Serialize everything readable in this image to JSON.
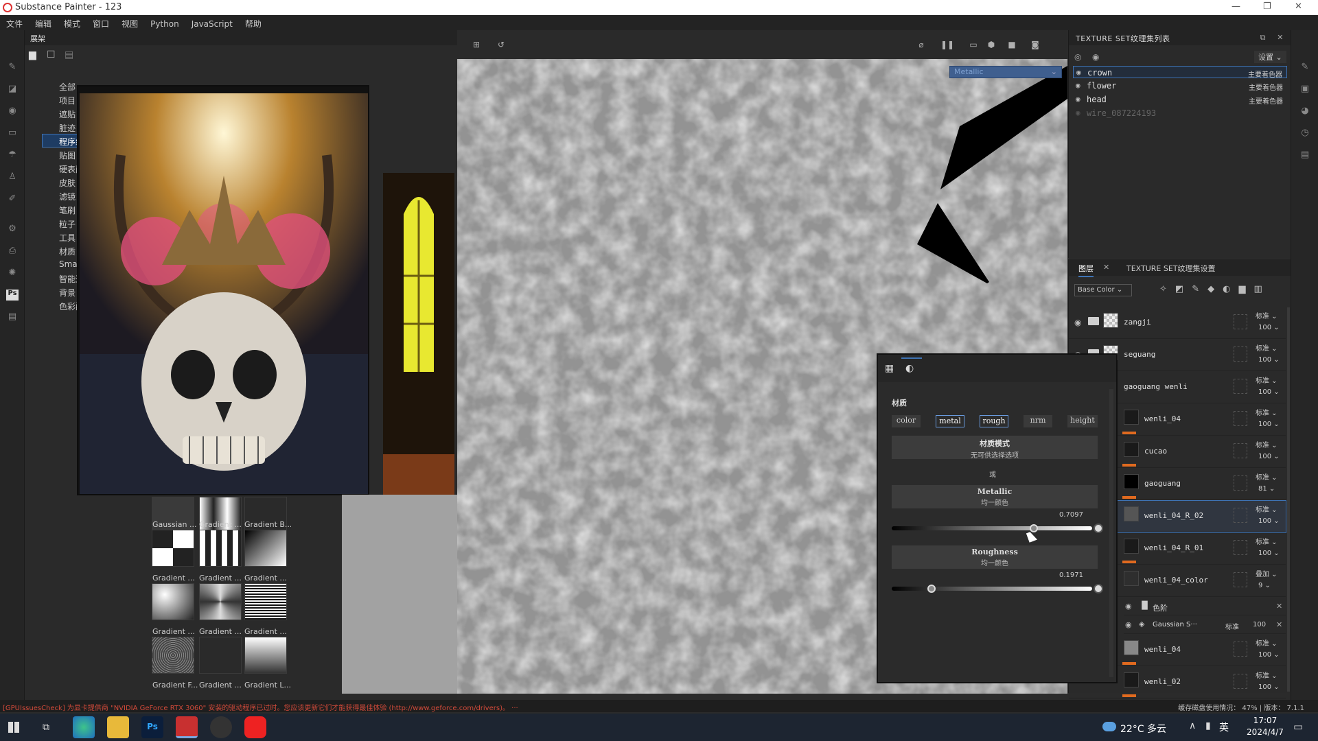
{
  "window": {
    "title": "Substance Painter - 123"
  },
  "menu": [
    "文件",
    "编辑",
    "模式",
    "窗口",
    "视图",
    "Python",
    "JavaScript",
    "帮助"
  ],
  "shelf": {
    "title": "展架",
    "categories": [
      "全部",
      "项目",
      "遮贴",
      "脏迹",
      "程序纹理",
      "贴图",
      "硬表面",
      "皮肤",
      "滤镜",
      "笔刷",
      "粒子",
      "工具",
      "材质",
      "Smart Ma",
      "智能遮罩",
      "背景",
      "色彩配置"
    ],
    "active_category": "程序纹理",
    "thumb_labels": [
      "Gaussian ...",
      "Gradient ...",
      "Gradient B...",
      "Gradient ...",
      "Gradient ...",
      "Gradient ...",
      "Gradient ...",
      "Gradient ...",
      "Gradient ...",
      "Gradient F...",
      "Gradient ...",
      "Gradient L..."
    ]
  },
  "viewport": {
    "channel_dropdown": "Metallic"
  },
  "texture_set_list": {
    "title": "TEXTURE SET纹理集列表",
    "settings_label": "设置",
    "items": [
      {
        "name": "crown",
        "shader": "主要着色器"
      },
      {
        "name": "flower",
        "shader": "主要着色器"
      },
      {
        "name": "head",
        "shader": "主要着色器"
      },
      {
        "name": "wire_087224193",
        "shader": ""
      }
    ]
  },
  "layers": {
    "tab_layers": "图层",
    "tab_settings": "TEXTURE SET纹理集设置",
    "channel": "Base Color",
    "items": [
      {
        "name": "zangji",
        "blend": "标准",
        "opacity": "100"
      },
      {
        "name": "seguang",
        "blend": "标准",
        "opacity": "100"
      },
      {
        "name": "gaoguang wenli",
        "blend": "标准",
        "opacity": "100"
      },
      {
        "name": "wenli_04",
        "blend": "标准",
        "opacity": "100"
      },
      {
        "name": "cucao",
        "blend": "标准",
        "opacity": "100"
      },
      {
        "name": "gaoguang",
        "blend": "标准",
        "opacity": "81"
      },
      {
        "name": "wenli_04_R_02",
        "blend": "标准",
        "opacity": "100"
      },
      {
        "name": "wenli_04_R_01",
        "blend": "标准",
        "opacity": "100"
      },
      {
        "name": "wenli_04_color",
        "blend": "叠加",
        "opacity": "9"
      }
    ],
    "effects": [
      {
        "name": "色阶"
      },
      {
        "name": "Gaussian S···",
        "blend": "标准",
        "opacity": "100"
      }
    ],
    "bottom_items": [
      {
        "name": "wenli_04",
        "blend": "标准",
        "opacity": "100"
      },
      {
        "name": "wenli_02",
        "blend": "标准",
        "opacity": "100"
      }
    ]
  },
  "properties": {
    "section": "材质",
    "chips": [
      "color",
      "metal",
      "rough",
      "nrm",
      "height"
    ],
    "material_mode_title": "材质模式",
    "material_mode_value": "无可供选择选项",
    "or_label": "或",
    "metallic_title": "Metallic",
    "metallic_sub": "均一颜色",
    "metallic_value": "0.7097",
    "metallic_level": 0.7097,
    "roughness_title": "Roughness",
    "roughness_sub": "均一颜色",
    "roughness_value": "0.1971",
    "roughness_level": 0.1971
  },
  "status": {
    "warning": "[GPUIssuesCheck] 为显卡提供商 \"NVIDIA GeForce RTX 3060\" 安装的驱动程序已过时。您应该更新它们才能获得最佳体验 (http://www.geforce.com/drivers)。 ···",
    "right": "缓存磁盘使用情况： 47% | 版本： 7.1.1"
  },
  "taskbar": {
    "weather": "22°C 多云",
    "ime": "英",
    "time": "17:07",
    "date": "2024/4/7"
  },
  "colors": {
    "accent": "#3e73b5",
    "layer_bar": "#e06a1f",
    "warning": "#d24a3a"
  }
}
